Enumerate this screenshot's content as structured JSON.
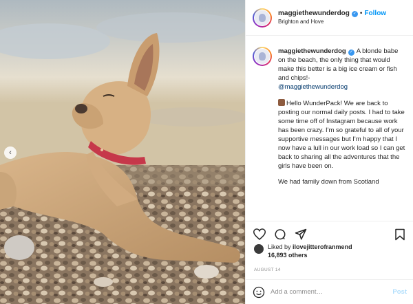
{
  "post": {
    "username": "maggiethewunderdog",
    "separator": "•",
    "follow_label": "Follow",
    "location": "Brighton and Hove",
    "caption_text": "A blonde babe on the beach, the only thing that would make this better is a big ice cream or fish and chips!-",
    "caption_mention": "@maggiethewunderdog",
    "comment_paragraph_1": "Hello WunderPack! We are back to posting our normal daily posts. I had to take some time off of Instagram because work has been crazy. I'm so grateful to all of your supportive messages but I'm happy that I now have a lull in our work load so I can get back to sharing all the adventures that the girls have been on.",
    "comment_paragraph_2": "We had family down from Scotland",
    "liked_by_prefix": "Liked by",
    "liked_by_user": "ilovejitterofranmend",
    "likes_count": "16,893 others",
    "date": "AUGUST 14",
    "comment_placeholder": "Add a comment…",
    "post_label": "Post"
  },
  "icons": {
    "carousel_prev": "chevron-left-icon",
    "verified": "verified-badge-icon",
    "like": "heart-icon",
    "comment": "comment-icon",
    "share": "share-icon",
    "save": "bookmark-icon",
    "emoji": "smiley-icon"
  },
  "colors": {
    "follow": "#0095f6",
    "verified": "#3897f0",
    "post_disabled": "#b2dffc",
    "meta_gray": "#8e8e8e"
  }
}
